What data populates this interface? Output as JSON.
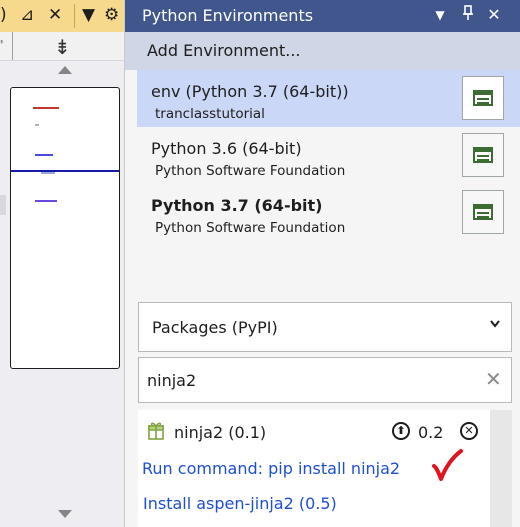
{
  "left": {
    "tab_paren": ")",
    "tab_pin": "⊿",
    "tab_close": "✕",
    "tab_dropdown": "▼",
    "tab_gear": "⚙",
    "split_icon": "⇟",
    "left_char": "\""
  },
  "panel": {
    "title": "Python Environments",
    "header_buttons": {
      "dropdown": "▼",
      "pin": "🖈",
      "close": "✕"
    },
    "add_environment": "Add Environment...",
    "environments": [
      {
        "name": "env (Python 3.7 (64-bit))",
        "subtitle": "tranclasstutorial",
        "selected": true,
        "bold": false
      },
      {
        "name": "Python 3.6 (64-bit)",
        "subtitle": "Python Software Foundation",
        "selected": false,
        "bold": false
      },
      {
        "name": "Python 3.7 (64-bit)",
        "subtitle": "Python Software Foundation",
        "selected": false,
        "bold": true
      }
    ],
    "view_selector": {
      "value": "Packages (PyPI)",
      "chevron": "⌄"
    },
    "search": {
      "value": "ninja2",
      "clear": "✕"
    },
    "package": {
      "name": "ninja2 (0.1)",
      "upgrade_version": "0.2",
      "upgrade_icon": "⬆",
      "uninstall_icon": "✕"
    },
    "run_command": "Run command: pip install ninja2",
    "install_link": "Install aspen-jinja2 (0.5)"
  },
  "colors": {
    "header": "#40568d",
    "selected_row": "#cad7f6",
    "link": "#1d4fd0",
    "tab_bar": "#f6d98c",
    "checkmark": "#e0141e"
  },
  "icons": [
    "gear-icon",
    "close-icon",
    "pin-icon",
    "split-icon",
    "environment-view-icon",
    "gift-icon",
    "upgrade-icon",
    "uninstall-icon",
    "checkmark-annotation"
  ]
}
